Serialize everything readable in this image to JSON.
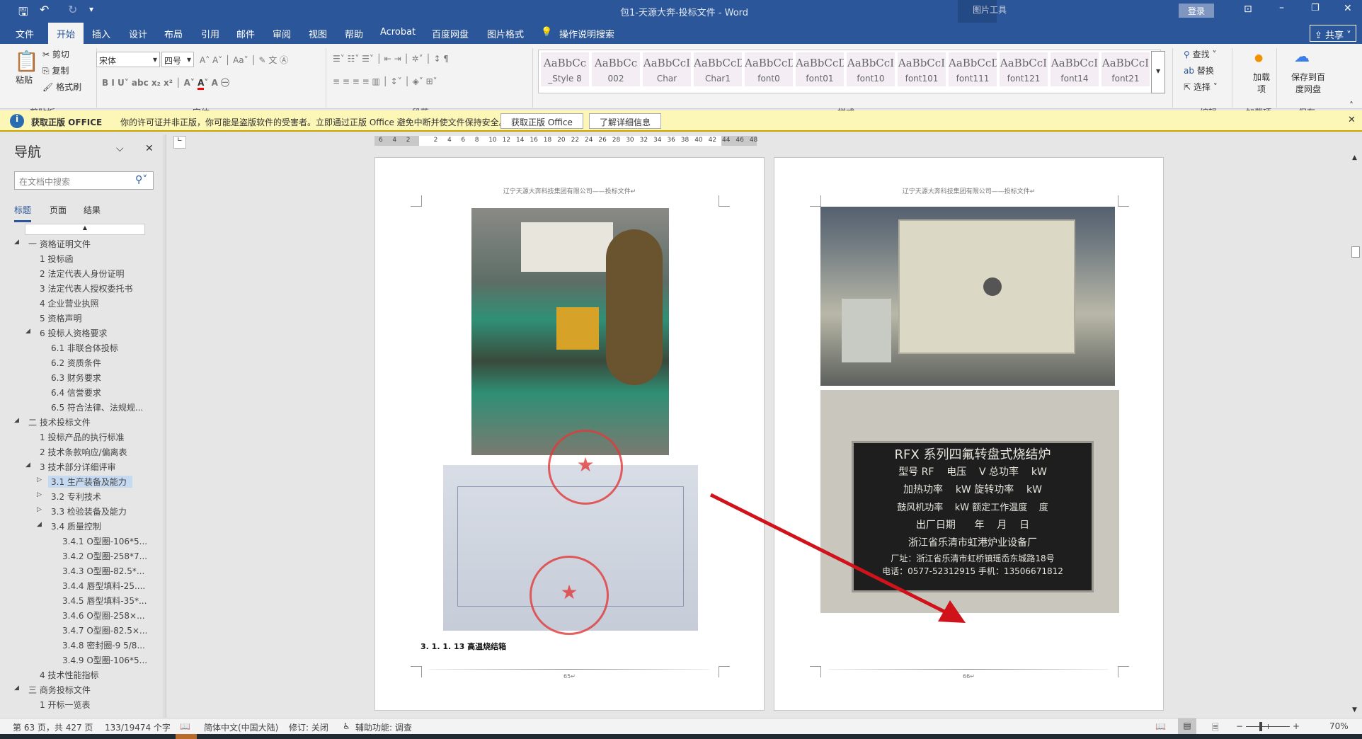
{
  "title": {
    "doc_title": "包1-天源大奔-投标文件 - Word",
    "context_tab_group": "图片工具",
    "login": "登录",
    "share": "共享"
  },
  "tabs": [
    {
      "label": "文件"
    },
    {
      "label": "开始"
    },
    {
      "label": "插入"
    },
    {
      "label": "设计"
    },
    {
      "label": "布局"
    },
    {
      "label": "引用"
    },
    {
      "label": "邮件"
    },
    {
      "label": "审阅"
    },
    {
      "label": "视图"
    },
    {
      "label": "帮助"
    },
    {
      "label": "Acrobat"
    },
    {
      "label": "百度网盘"
    },
    {
      "label": "图片格式"
    }
  ],
  "tell_me": "操作说明搜索",
  "ribbon": {
    "clipboard": {
      "paste": "粘贴",
      "cut": "剪切",
      "copy": "复制",
      "format_painter": "格式刷",
      "group": "剪贴板"
    },
    "font": {
      "name": "宋体",
      "size": "四号",
      "group": "字体"
    },
    "paragraph": {
      "group": "段落"
    },
    "styles": {
      "group": "样式",
      "items": [
        {
          "preview": "AaBbCc",
          "name": "_Style 8"
        },
        {
          "preview": "AaBbCc",
          "name": "002"
        },
        {
          "preview": "AaBbCcI",
          "name": "Char"
        },
        {
          "preview": "AaBbCcDc",
          "name": "Char1"
        },
        {
          "preview": "AaBbCcDc",
          "name": "font0"
        },
        {
          "preview": "AaBbCcDc",
          "name": "font01"
        },
        {
          "preview": "AaBbCcI",
          "name": "font10"
        },
        {
          "preview": "AaBbCcI",
          "name": "font101"
        },
        {
          "preview": "AaBbCcDc",
          "name": "font111"
        },
        {
          "preview": "AaBbCcI",
          "name": "font121"
        },
        {
          "preview": "AaBbCcI",
          "name": "font14"
        },
        {
          "preview": "AaBbCcI",
          "name": "font21"
        }
      ]
    },
    "editing": {
      "find": "查找",
      "replace": "替换",
      "select": "选择",
      "group": "编辑"
    },
    "addins": {
      "label": "加载项",
      "group": "加载项"
    },
    "save": {
      "label": "保存到百度网盘",
      "group": "保存"
    }
  },
  "warning": {
    "title": "获取正版 OFFICE",
    "message": "你的许可证并非正版，你可能是盗版软件的受害者。立即通过正版 Office 避免中断并使文件保持安全。",
    "btn_get": "获取正版 Office",
    "btn_learn": "了解详细信息"
  },
  "ruler": {
    "ticks": [
      "6",
      "4",
      "2",
      "",
      "2",
      "4",
      "6",
      "8",
      "10",
      "12",
      "14",
      "16",
      "18",
      "20",
      "22",
      "24",
      "26",
      "28",
      "30",
      "32",
      "34",
      "36",
      "38",
      "40",
      "42",
      "44",
      "46",
      "48"
    ]
  },
  "nav": {
    "title": "导航",
    "search_placeholder": "在文档中搜索",
    "tabs": [
      "标题",
      "页面",
      "结果"
    ],
    "items": [
      {
        "label": "一 资格证明文件",
        "level": 0,
        "toggle": "◢"
      },
      {
        "label": "1 投标函",
        "level": 1
      },
      {
        "label": "2 法定代表人身份证明",
        "level": 1
      },
      {
        "label": "3 法定代表人授权委托书",
        "level": 1
      },
      {
        "label": "4 企业营业执照",
        "level": 1
      },
      {
        "label": "5 资格声明",
        "level": 1
      },
      {
        "label": "6 投标人资格要求",
        "level": 1,
        "toggle": "◢"
      },
      {
        "label": "6.1 非联合体投标",
        "level": 2
      },
      {
        "label": "6.2 资质条件",
        "level": 2
      },
      {
        "label": "6.3 财务要求",
        "level": 2
      },
      {
        "label": "6.4 信誉要求",
        "level": 2
      },
      {
        "label": "6.5 符合法律、法规规...",
        "level": 2
      },
      {
        "label": "二 技术投标文件",
        "level": 0,
        "toggle": "◢"
      },
      {
        "label": "1 投标产品的执行标准",
        "level": 1
      },
      {
        "label": "2 技术条款响应/偏离表",
        "level": 1
      },
      {
        "label": "3 技术部分详细评审",
        "level": 1,
        "toggle": "◢"
      },
      {
        "label": "3.1 生产装备及能力",
        "level": 2,
        "toggle": "▷",
        "selected": true
      },
      {
        "label": "3.2 专利技术",
        "level": 2,
        "toggle": "▷"
      },
      {
        "label": "3.3 检验装备及能力",
        "level": 2,
        "toggle": "▷"
      },
      {
        "label": "3.4 质量控制",
        "level": 2,
        "toggle": "◢"
      },
      {
        "label": "3.4.1 O型圈-106*5...",
        "level": 3
      },
      {
        "label": "3.4.2 O型圈-258*7...",
        "level": 3
      },
      {
        "label": "3.4.3 O型圈-82.5*...",
        "level": 3
      },
      {
        "label": "3.4.4 唇型填料-25....",
        "level": 3
      },
      {
        "label": "3.4.5 唇型填料-35*...",
        "level": 3
      },
      {
        "label": "3.4.6 O型圈-258×...",
        "level": 3
      },
      {
        "label": "3.4.7 O型圈-82.5×...",
        "level": 3
      },
      {
        "label": "3.4.8 密封圈-9 5/8...",
        "level": 3
      },
      {
        "label": "3.4.9 O型圈-106*5...",
        "level": 3
      },
      {
        "label": "4 技术性能指标",
        "level": 1
      },
      {
        "label": "三 商务投标文件",
        "level": 0,
        "toggle": "◢"
      },
      {
        "label": "1 开标一览表",
        "level": 1
      }
    ]
  },
  "page1": {
    "header": "辽宁天源大奔科技集团有限公司——投标文件↵",
    "heading": "3. 1. 1. 13 高温烧结箱",
    "footer": "65↵"
  },
  "page2": {
    "header": "辽宁天源大奔科技集团有限公司——投标文件↵",
    "footer": "66↵",
    "nameplate": {
      "title": "RFX 系列四氟转盘式烧结炉",
      "row1": "型号 RF    电压    V 总功率    kW",
      "row2": "加热功率    kW 旋转功率    kW",
      "row3": "鼓风机功率    kW 额定工作温度    度",
      "row4": "出厂日期      年    月    日",
      "maker": "浙江省乐清市虹港炉业设备厂",
      "address": "厂址：浙江省乐清市虹桥镇瑶岙东城路18号",
      "phone": "电话：0577-52312915  手机：13506671812"
    }
  },
  "status": {
    "page": "第 63 页，共 427 页",
    "words": "133/19474 个字",
    "language": "简体中文(中国大陆)",
    "track": "修订: 关闭",
    "accessibility": "辅助功能: 调查",
    "zoom": "70%",
    "zoom_percent": 70
  },
  "colors": {
    "brand": "#2b579a",
    "warning_bg": "#fcf7b6",
    "arrow": "#d0121b"
  }
}
